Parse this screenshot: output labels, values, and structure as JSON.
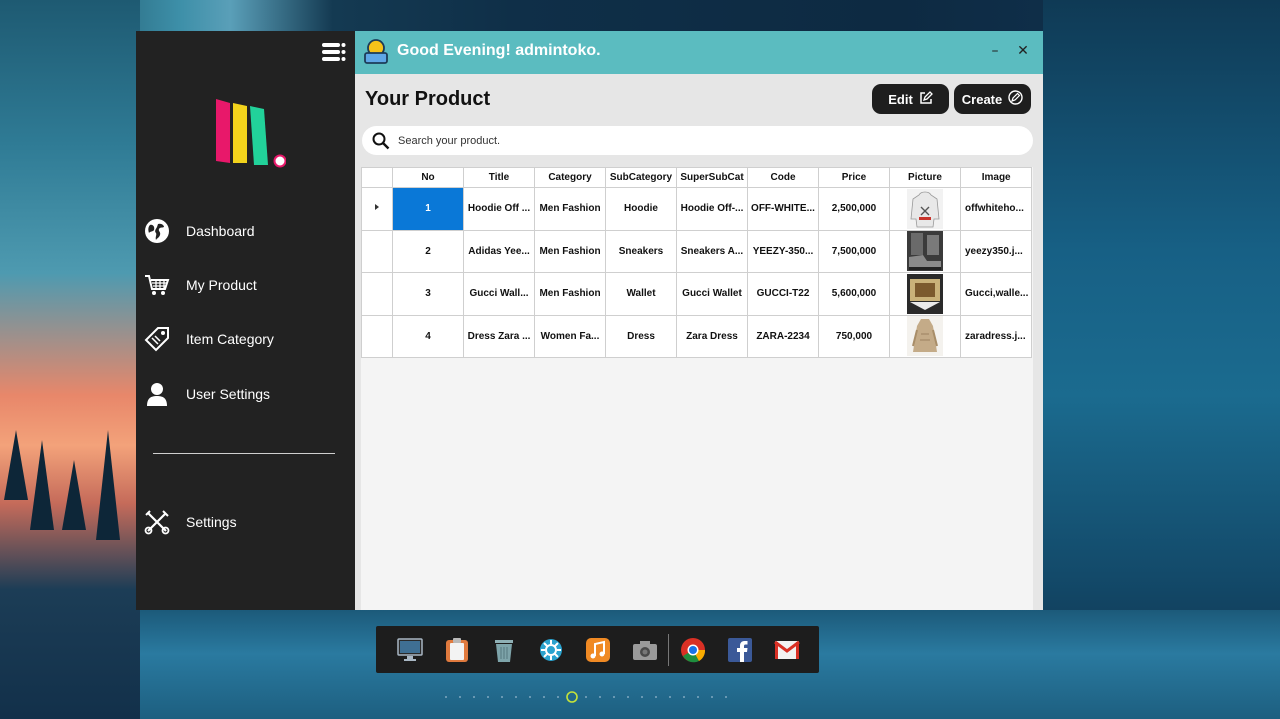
{
  "sidebar": {
    "items": [
      {
        "label": "Dashboard",
        "icon": "globe-icon"
      },
      {
        "label": "My Product",
        "icon": "cart-icon"
      },
      {
        "label": "Item Category",
        "icon": "tag-icon"
      },
      {
        "label": "User Settings",
        "icon": "user-icon"
      }
    ],
    "settings": {
      "label": "Settings",
      "icon": "wrench-screwdriver-icon"
    }
  },
  "header": {
    "greeting": "Good Evening! admintoko.",
    "minimize": "–",
    "close": "✕",
    "accent": "#5bbcc0"
  },
  "main": {
    "title": "Your Product",
    "edit_label": "Edit",
    "create_label": "Create",
    "search_placeholder": "Search your product."
  },
  "table": {
    "columns": [
      "No",
      "Title",
      "Category",
      "SubCategory",
      "SuperSubCat",
      "Code",
      "Price",
      "Picture",
      "Image"
    ],
    "rows": [
      {
        "no": "1",
        "title": "Hoodie Off ...",
        "category": "Men Fashion",
        "sub": "Hoodie",
        "supersub": "Hoodie Off-...",
        "code": "OFF-WHITE...",
        "price": "2,500,000",
        "picture": "hoodie",
        "image": "offwhiteho..."
      },
      {
        "no": "2",
        "title": "Adidas Yee...",
        "category": "Men Fashion",
        "sub": "Sneakers",
        "supersub": "Sneakers A...",
        "code": "YEEZY-350...",
        "price": "7,500,000",
        "picture": "sneakers",
        "image": "yeezy350.j..."
      },
      {
        "no": "3",
        "title": "Gucci Wall...",
        "category": "Men Fashion",
        "sub": "Wallet",
        "supersub": "Gucci Wallet",
        "code": "GUCCI-T22",
        "price": "5,600,000",
        "picture": "wallet",
        "image": "Gucci,walle..."
      },
      {
        "no": "4",
        "title": "Dress Zara ...",
        "category": "Women Fa...",
        "sub": "Dress",
        "supersub": "Zara Dress",
        "code": "ZARA-2234",
        "price": "750,000",
        "picture": "dress",
        "image": "zaradress.j..."
      }
    ],
    "selected_color": "#0a78d7"
  },
  "dock": {
    "items": [
      "monitor-icon",
      "clipboard-icon",
      "trash-icon",
      "gear-flower-icon",
      "music-icon",
      "camera-icon",
      "chrome-icon",
      "facebook-icon",
      "gmail-icon"
    ]
  }
}
